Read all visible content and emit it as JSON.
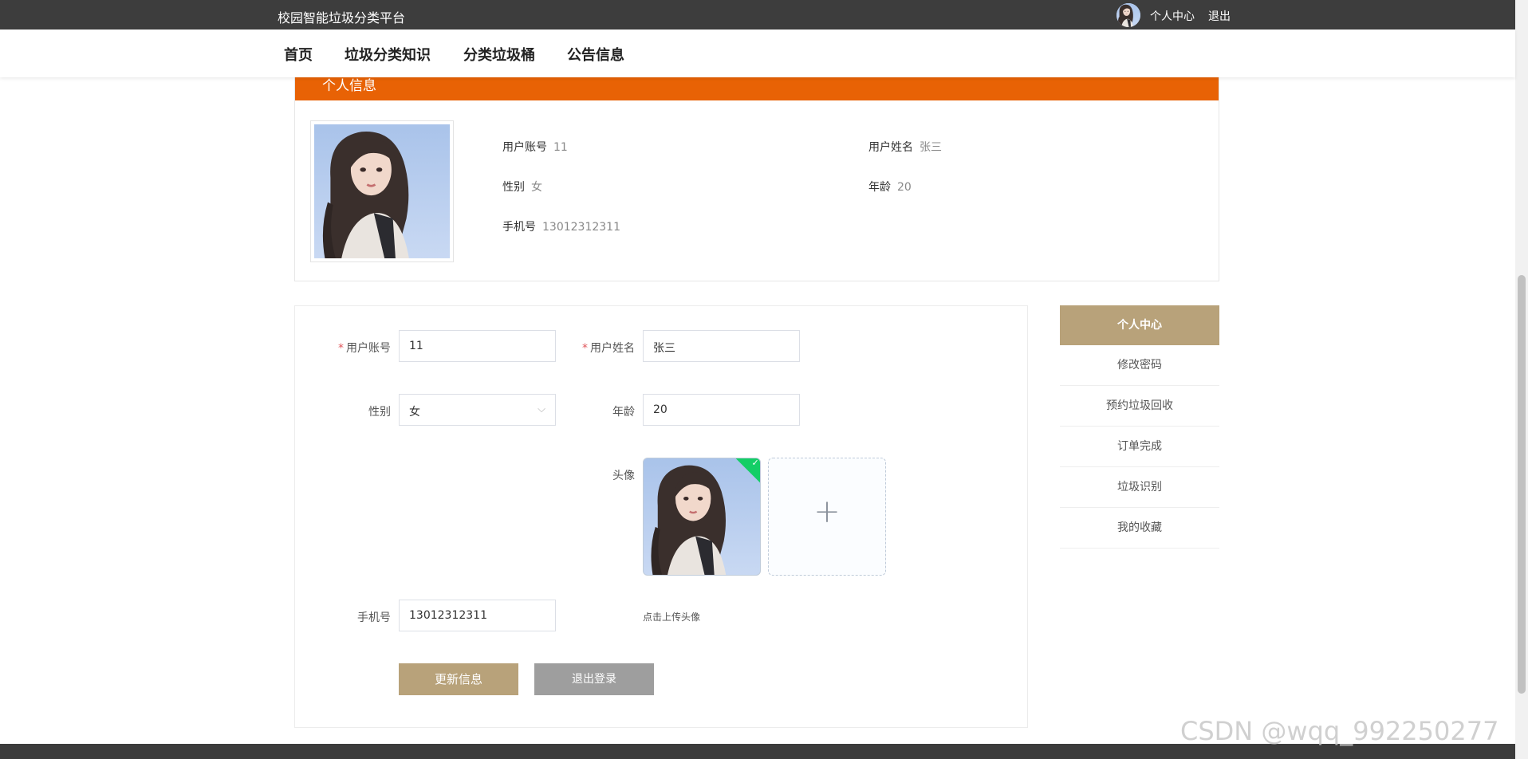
{
  "topbar": {
    "site_title": "校园智能垃圾分类平台",
    "personal_center": "个人中心",
    "logout": "退出"
  },
  "nav": {
    "items": [
      "首页",
      "垃圾分类知识",
      "分类垃圾桶",
      "公告信息"
    ]
  },
  "profile": {
    "header": "个人信息",
    "account_label": "用户账号",
    "account_value": "11",
    "name_label": "用户姓名",
    "name_value": "张三",
    "gender_label": "性别",
    "gender_value": "女",
    "age_label": "年龄",
    "age_value": "20",
    "phone_label": "手机号",
    "phone_value": "13012312311"
  },
  "form": {
    "required_mark": "*",
    "account_label": "用户账号",
    "account_value": "11",
    "name_label": "用户姓名",
    "name_value": "张三",
    "gender_label": "性别",
    "gender_value": "女",
    "age_label": "年龄",
    "age_value": "20",
    "avatar_label": "头像",
    "upload_hint": "点击上传头像",
    "phone_label": "手机号",
    "phone_value": "13012312311",
    "update_button": "更新信息",
    "logout_button": "退出登录"
  },
  "side_menu": {
    "header": "个人中心",
    "items": [
      "修改密码",
      "预约垃圾回收",
      "订单完成",
      "垃圾识别",
      "我的收藏"
    ]
  },
  "watermark": "CSDN @wqq_992250277",
  "colors": {
    "topbar": "#3d3d3d",
    "profile_header": "#e86205",
    "accent": "#b8a27a",
    "logout_button": "#9e9e9e",
    "success": "#13ce66"
  }
}
